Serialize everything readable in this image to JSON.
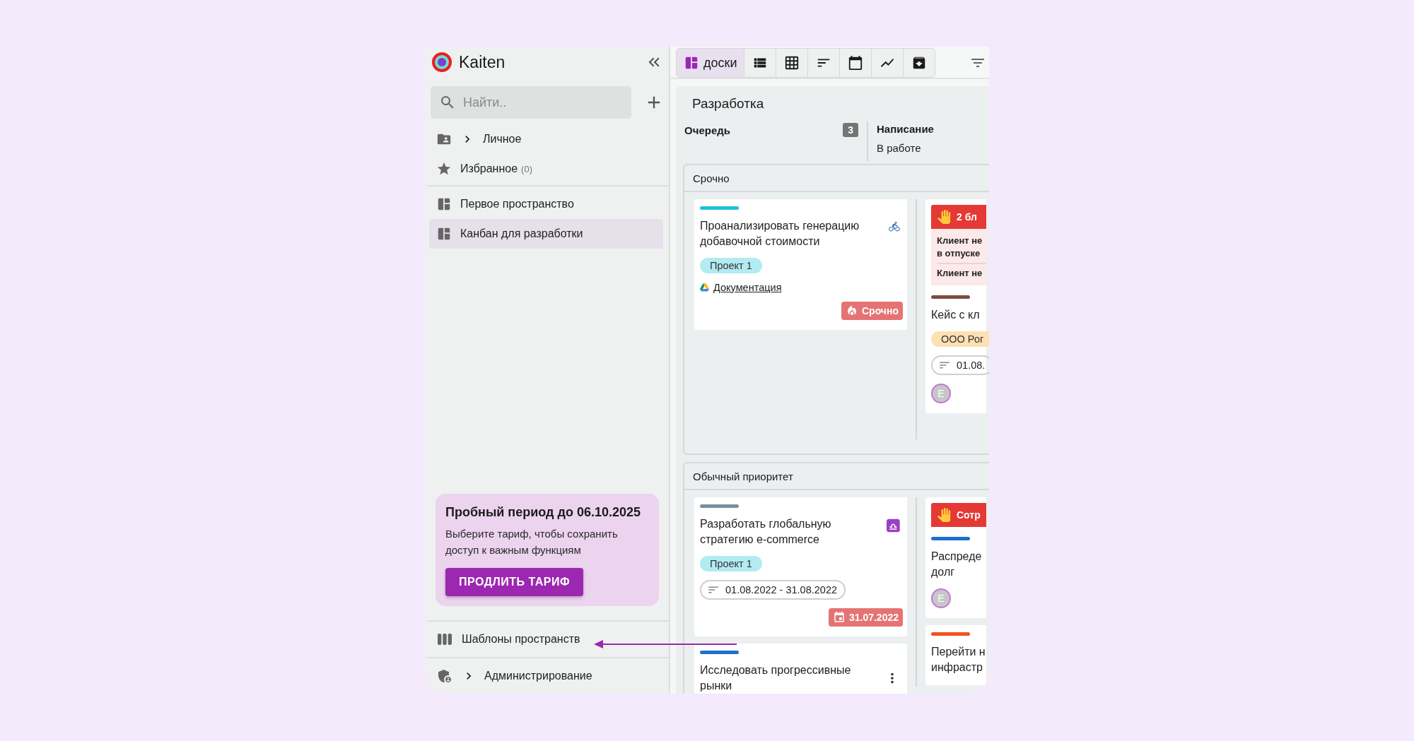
{
  "sidebar": {
    "brand": "Kaiten",
    "search": {
      "placeholder": "Найти.."
    },
    "items": [
      {
        "kind": "folder",
        "label": "Личное",
        "expanded": false
      },
      {
        "kind": "favorites",
        "label": "Избранное",
        "count": "(0)"
      }
    ],
    "spaces": [
      {
        "label": "Первое пространство",
        "selected": false
      },
      {
        "label": "Канбан для разработки",
        "selected": true
      }
    ],
    "trial": {
      "title": "Пробный период до 06.10.2025",
      "text": "Выберите тариф, чтобы сохранить доступ к важным функциям",
      "button": "ПРОДЛИТЬ ТАРИФ"
    },
    "footer_items": [
      {
        "kind": "templates",
        "label": "Шаблоны пространств"
      },
      {
        "kind": "admin",
        "label": "Администрирование",
        "expanded": false
      }
    ]
  },
  "toolbar": {
    "views": [
      {
        "kind": "boards",
        "label": "доски",
        "selected": true
      },
      {
        "kind": "list",
        "selected": false
      },
      {
        "kind": "table",
        "selected": false
      },
      {
        "kind": "timeline",
        "selected": false
      },
      {
        "kind": "calendar",
        "selected": false
      },
      {
        "kind": "chart",
        "selected": false
      },
      {
        "kind": "archive",
        "selected": false
      }
    ]
  },
  "board": {
    "title": "Разработка",
    "columns": [
      {
        "title": "Очередь",
        "count": "3"
      },
      {
        "title": "Написание",
        "subtitle": "В работе"
      }
    ],
    "lanes": [
      {
        "title": "Срочно",
        "cells": [
          [
            {
              "color": "#1fc0d8",
              "title": "Проанализировать генерацию добавочной стоимости",
              "kind": "bicycle",
              "tags": [
                {
                  "label": "Проект 1",
                  "color": "#b2ebf2"
                }
              ],
              "link": "Документация",
              "badge": {
                "kind": "urgent",
                "label": "Срочно"
              }
            }
          ],
          [
            {
              "blocked": {
                "label": "2 бл",
                "reasons": [
                  "Клиент не\nв отпуске",
                  "Клиент не"
                ]
              },
              "color": "#7a4e3f",
              "title": "Кейс с кл",
              "tags": [
                {
                  "label": "ООО Рог",
                  "color": "#ffe0b2"
                }
              ],
              "dates": "01.08.",
              "avatar": "E"
            }
          ]
        ]
      },
      {
        "title": "Обычный приоритет",
        "cells": [
          [
            {
              "color": "#78909c",
              "title": "Разработать глобальную стратегию e-commerce",
              "kind": "libra",
              "tags": [
                {
                  "label": "Проект 1",
                  "color": "#b2ebf2"
                }
              ],
              "dates": "01.08.2022 - 31.08.2022",
              "badge": {
                "kind": "due",
                "label": "31.07.2022"
              }
            },
            {
              "color": "#1e6fd0",
              "title": "Исследовать прогрессивные\nрынки",
              "menu": true
            }
          ],
          [
            {
              "blocked": {
                "label": "Сотр"
              },
              "color": "#1e6fd0",
              "title": "Распреде\nдолг",
              "avatar": "E"
            },
            {
              "color": "#f4511e",
              "title": "Перейти н\nинфрастр"
            }
          ]
        ]
      }
    ]
  }
}
